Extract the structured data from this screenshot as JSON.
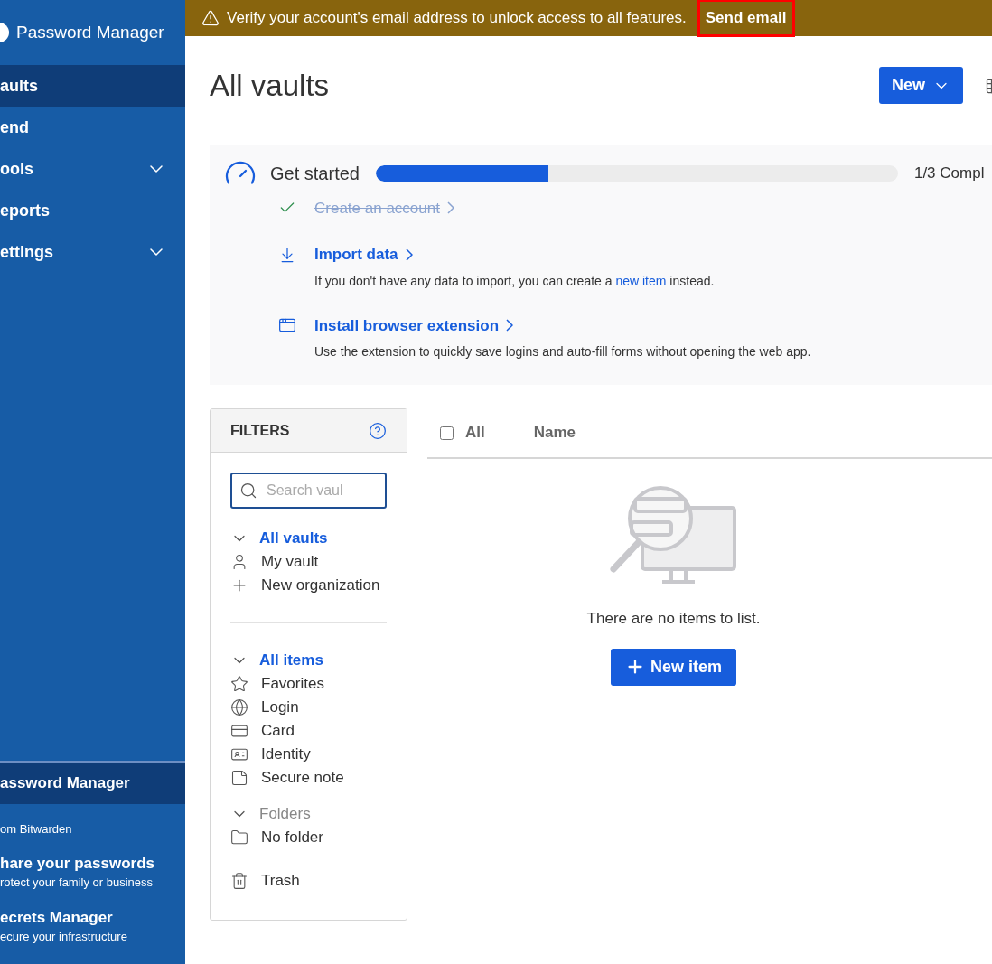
{
  "sidebar": {
    "logo_text": "Password Manager",
    "items": [
      {
        "label": "aults",
        "selected": true,
        "expandable": false
      },
      {
        "label": "end",
        "selected": false,
        "expandable": false
      },
      {
        "label": "ools",
        "selected": false,
        "expandable": true
      },
      {
        "label": "eports",
        "selected": false,
        "expandable": false
      },
      {
        "label": "ettings",
        "selected": false,
        "expandable": true
      }
    ],
    "product_switcher": {
      "current": "assword Manager",
      "caption": "om Bitwarden",
      "products": [
        {
          "title": "hare your passwords",
          "subtitle": "rotect your family or business"
        },
        {
          "title": "ecrets Manager",
          "subtitle": "ecure your infrastructure"
        }
      ]
    }
  },
  "banner": {
    "message": "Verify your account's email address to unlock access to all features.",
    "action": "Send email",
    "highlighted": true
  },
  "header": {
    "title": "All vaults",
    "new_button": "New"
  },
  "get_started": {
    "title": "Get started",
    "level": 0.33,
    "progress_text": "1/3 Compl",
    "tasks": [
      {
        "kind": "account",
        "title": "Create an account",
        "completed": true
      },
      {
        "kind": "import",
        "title": "Import data",
        "completed": false,
        "description_before": "If you don't have any data to import, you can create a",
        "link": "new item",
        "description_after": "instead."
      },
      {
        "kind": "extension",
        "title": "Install browser extension",
        "completed": false,
        "description_before": "Use the extension to quickly save logins and auto-fill forms without opening the web app."
      }
    ]
  },
  "filters": {
    "title": "FILTERS",
    "search_placeholder": "Search vaul",
    "sections": [
      {
        "label": "All vaults",
        "selected": true,
        "expanded": true,
        "items": [
          {
            "kind": "user",
            "label": "My vault"
          },
          {
            "kind": "plus",
            "label": "New organization"
          }
        ]
      },
      {
        "label": "All items",
        "selected": true,
        "expanded": true,
        "items": [
          {
            "kind": "star",
            "label": "Favorites"
          },
          {
            "kind": "globe",
            "label": "Login"
          },
          {
            "kind": "card",
            "label": "Card"
          },
          {
            "kind": "id",
            "label": "Identity"
          },
          {
            "kind": "note",
            "label": "Secure note"
          }
        ]
      },
      {
        "label": "Folders",
        "selected": false,
        "expanded": true,
        "items": [
          {
            "kind": "folder",
            "label": "No folder"
          }
        ]
      }
    ],
    "trash": {
      "label": "Trash"
    }
  },
  "table": {
    "select_all": {
      "label": "All",
      "checked": false
    },
    "columns": [
      "Name"
    ],
    "empty_message": "There are no items to list.",
    "new_item_button": "New item"
  }
}
